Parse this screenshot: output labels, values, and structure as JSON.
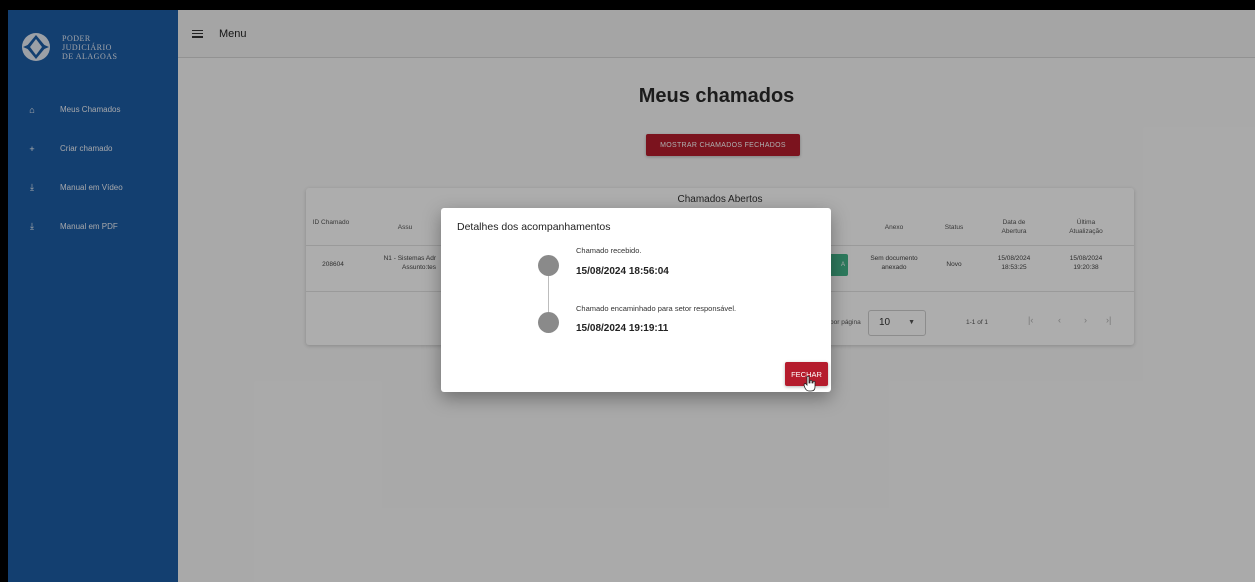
{
  "brand": {
    "lines": [
      "PODER",
      "JUDICIÁRIO",
      "DE ALAGOAS"
    ]
  },
  "sidebar": {
    "items": [
      {
        "label": "Meus Chamados",
        "icon": "home-icon",
        "glyph": "⌂"
      },
      {
        "label": "Criar chamado",
        "icon": "plus-icon",
        "glyph": "+"
      },
      {
        "label": "Manual em Vídeo",
        "icon": "download-icon",
        "glyph": "⤓"
      },
      {
        "label": "Manual em PDF",
        "icon": "download-icon",
        "glyph": "⤓"
      }
    ]
  },
  "topbar": {
    "menu_label": "Menu"
  },
  "main": {
    "title": "Meus chamados",
    "show_closed_button": "MOSTRAR CHAMADOS FECHADOS",
    "table": {
      "title": "Chamados Abertos",
      "headers": {
        "id": "ID Chamado",
        "assunto": "Assu",
        "anexo": "Anexo",
        "status": "Status",
        "data_abertura": "Data de Abertura",
        "ultima_atualizacao": "Última Atualização"
      },
      "row": {
        "id": "208604",
        "assunto": "N1 - Sistemas Adr Assunto:tes",
        "action_fragment": "A",
        "anexo": "Sem documento anexado",
        "status": "Novo",
        "data_abertura": "15/08/2024 18:53:25",
        "ultima_atualizacao": "15/08/2024 19:20:38"
      },
      "paginator": {
        "per_page_label": "por página",
        "per_page_value": "10",
        "range": "1-1 of 1"
      }
    }
  },
  "dialog": {
    "title": "Detalhes dos acompanhamentos",
    "events": [
      {
        "description": "Chamado recebido.",
        "date": "15/08/2024 18:56:04"
      },
      {
        "description": "Chamado encaminhado para setor responsável.",
        "date": "15/08/2024 19:19:11"
      }
    ],
    "close_button": "FECHAR"
  },
  "colors": {
    "sidebar": "#1d5da6",
    "primary_red": "#b51c2d",
    "green": "#43b48a"
  }
}
